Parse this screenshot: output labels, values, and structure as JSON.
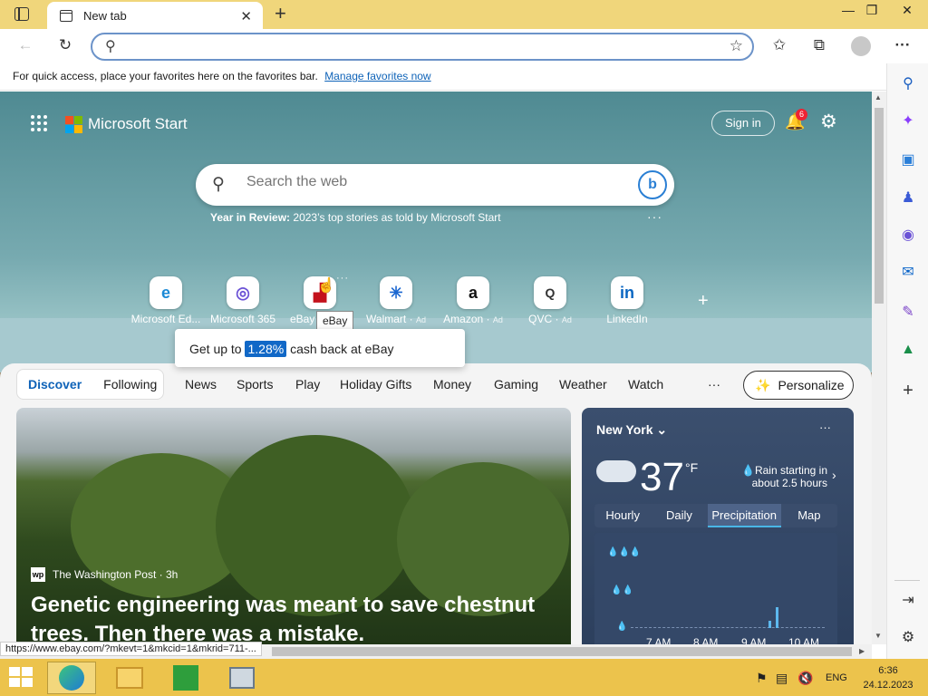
{
  "browser": {
    "tab_title": "New tab",
    "tab_close": "✕",
    "new_tab": "+",
    "window_controls": [
      "—",
      "❐",
      "✕"
    ],
    "address_value": "",
    "toolbar_more": "···"
  },
  "favorites_bar": {
    "message": "For quick access, place your favorites here on the favorites bar.",
    "link": "Manage favorites now"
  },
  "header": {
    "brand": "Microsoft Start",
    "sign_in": "Sign in",
    "notifications_count": "6"
  },
  "search": {
    "placeholder": "Search the web",
    "year_in_review_bold": "Year in Review:",
    "year_in_review_text": "2023’s top stories as told by Microsoft Start",
    "more": "···"
  },
  "quick_links": [
    {
      "label": "Microsoft Ed...",
      "ad": "",
      "icon": "edge-icon",
      "glyph": "e",
      "color": "#1c8ad6"
    },
    {
      "label": "Microsoft 365",
      "ad": "",
      "icon": "m365-icon",
      "glyph": "◎",
      "color": "#6b52d6"
    },
    {
      "label": "eBay",
      "ad": "",
      "icon": "ebay-icon",
      "glyph": "▟",
      "color": "#c4121c"
    },
    {
      "label": "Walmart",
      "ad": "Ad",
      "icon": "walmart-icon",
      "glyph": "✳",
      "color": "#1a66d0"
    },
    {
      "label": "Amazon",
      "ad": "Ad",
      "icon": "amazon-icon",
      "glyph": "a",
      "color": "#111"
    },
    {
      "label": "QVC",
      "ad": "Ad",
      "icon": "qvc-icon",
      "glyph": "Q",
      "color": "#333"
    },
    {
      "label": "LinkedIn",
      "ad": "",
      "icon": "linkedin-icon",
      "glyph": "in",
      "color": "#0a66c2"
    }
  ],
  "add_link": "+",
  "tooltip": "eBay",
  "promo": {
    "prefix": "Get up to",
    "percent": "1.28%",
    "suffix": "cash back at eBay"
  },
  "feed_nav": {
    "discover": "Discover",
    "following": "Following",
    "items": [
      "News",
      "Sports",
      "Play",
      "Holiday Gifts",
      "Money",
      "Gaming",
      "Weather",
      "Watch"
    ],
    "more": "···",
    "personalize": "Personalize"
  },
  "article": {
    "source_logo": "wp",
    "source": "The Washington Post · 3h",
    "headline": "Genetic engineering was meant to save chestnut trees. Then there was a mistake."
  },
  "weather": {
    "location": "New York",
    "temperature": "37",
    "unit": "°F",
    "forecast_line1": "Rain starting in",
    "forecast_line2": "about 2.5 hours",
    "tabs": [
      "Hourly",
      "Daily",
      "Precipitation",
      "Map"
    ],
    "selected_tab": "Precipitation",
    "time_labels": [
      "7 AM",
      "8 AM",
      "9 AM",
      "10 AM"
    ],
    "more": "···"
  },
  "status_url": "https://www.ebay.com/?mkevt=1&mkcid=1&mkrid=711-...",
  "taskbar": {
    "language": "ENG",
    "time": "6:36",
    "date": "24.12.2023"
  }
}
